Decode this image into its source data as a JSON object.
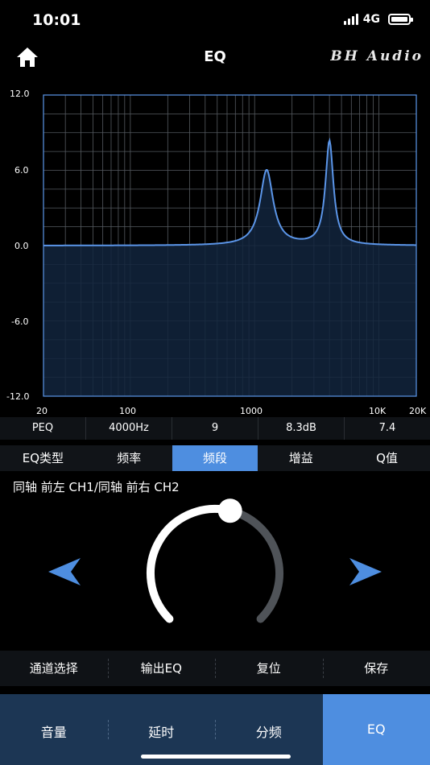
{
  "status_bar": {
    "time": "10:01",
    "network": "4G",
    "battery_level": 1.0
  },
  "nav": {
    "title": "EQ",
    "brand": "BH Audio"
  },
  "graph": {
    "y_ticks": [
      "12.0",
      "6.0",
      "0.0",
      "-6.0",
      "-12.0"
    ],
    "x_ticks": [
      "20",
      "100",
      "1000",
      "10K",
      "20K"
    ],
    "line_color": "#5b95e8",
    "fill_color": "#12253d",
    "grid_color": "#555a60",
    "chart_data": {
      "type": "line",
      "x_scale": "log",
      "xlim": [
        20,
        20000
      ],
      "ylim": [
        -12,
        12
      ],
      "baseline": 0,
      "peaks": [
        {
          "freq_hz": 1250,
          "gain_db": 6.0,
          "q": 4.5
        },
        {
          "freq_hz": 4000,
          "gain_db": 8.3,
          "q": 7.4
        }
      ]
    }
  },
  "params": {
    "type": "PEQ",
    "freq": "4000Hz",
    "band": "9",
    "gain": "8.3dB",
    "q": "7.4"
  },
  "tabs": {
    "eq_type": "EQ类型",
    "frequency": "频率",
    "band": "频段",
    "gain": "增益",
    "q_value": "Q值"
  },
  "channel_label": "同轴 前左 CH1/同轴 前右 CH2",
  "knob": {
    "value_fraction": 0.55,
    "track_color": "#ffffff",
    "rest_color": "#4f5358"
  },
  "actions": {
    "channel_select": "通道选择",
    "output_eq": "输出EQ",
    "reset": "复位",
    "save": "保存"
  },
  "bottom_nav": {
    "volume": "音量",
    "delay": "延时",
    "crossover": "分频",
    "eq": "EQ"
  },
  "accent_color": "#4e8ee0",
  "icons": {
    "home": "home-icon",
    "left": "arrow-left-icon",
    "right": "arrow-right-icon"
  }
}
